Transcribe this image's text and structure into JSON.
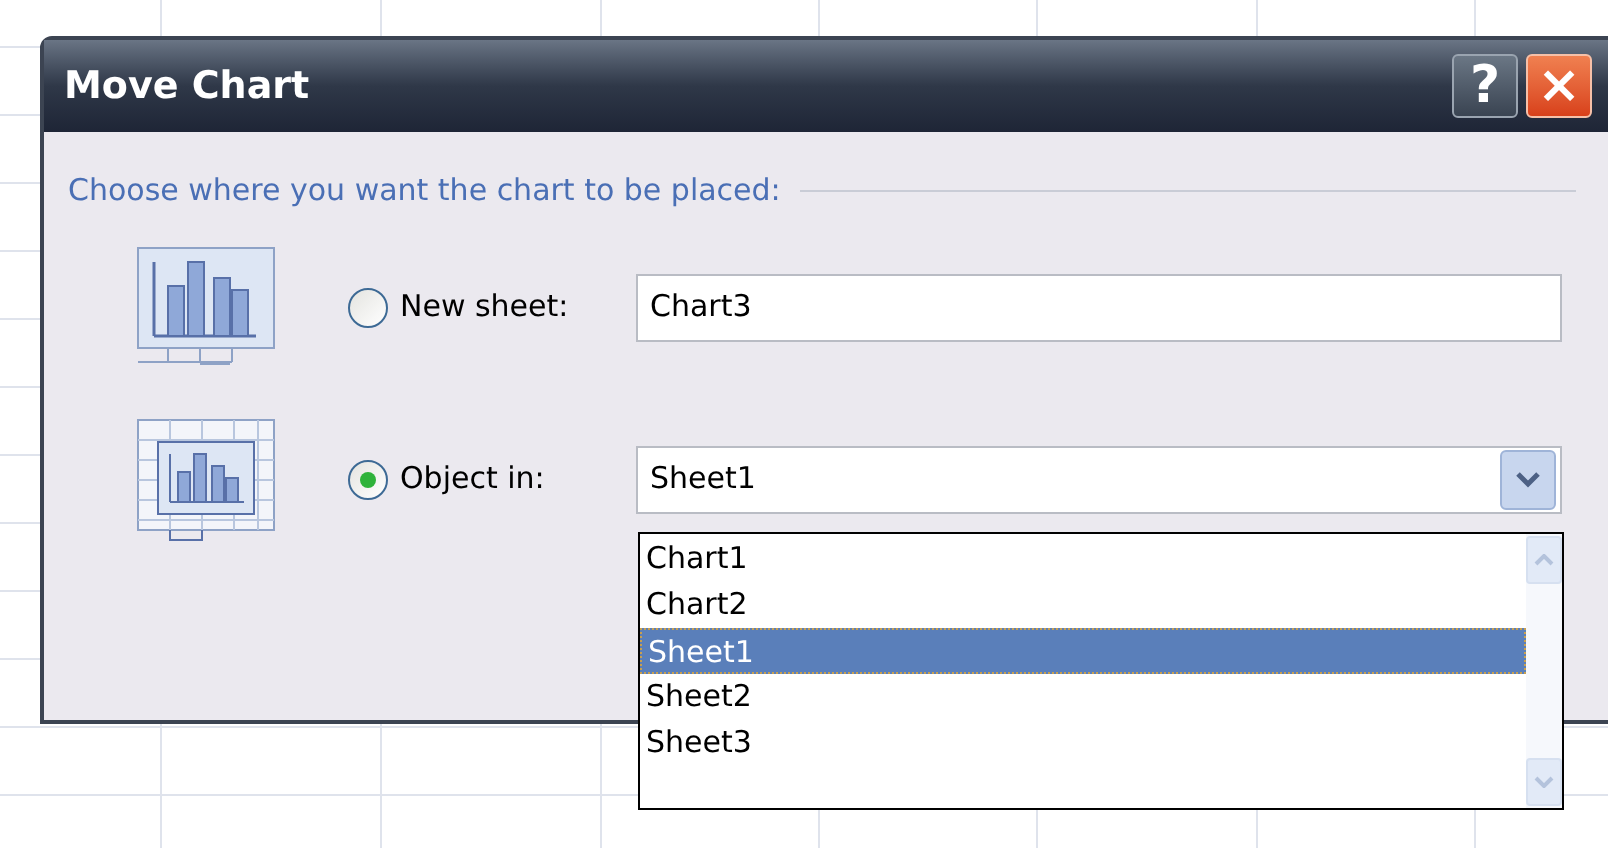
{
  "window": {
    "title": "Move Chart"
  },
  "title_buttons": [
    {
      "kind": "help",
      "label": "?"
    },
    {
      "kind": "close",
      "label": "×"
    }
  ],
  "prompt": "Choose where you want the chart to be placed:",
  "options": [
    {
      "kind": "new_sheet",
      "label": "New sheet:",
      "selected": false,
      "value": "Chart3"
    },
    {
      "kind": "object_in",
      "label": "Object in:",
      "selected": true,
      "value": "Sheet1",
      "expanded": true
    }
  ],
  "dropdown_items": [
    {
      "label": "Chart1",
      "selected": false
    },
    {
      "label": "Chart2",
      "selected": false
    },
    {
      "label": "Sheet1",
      "selected": true
    },
    {
      "label": "Sheet2",
      "selected": false
    },
    {
      "label": "Sheet3",
      "selected": false
    }
  ]
}
